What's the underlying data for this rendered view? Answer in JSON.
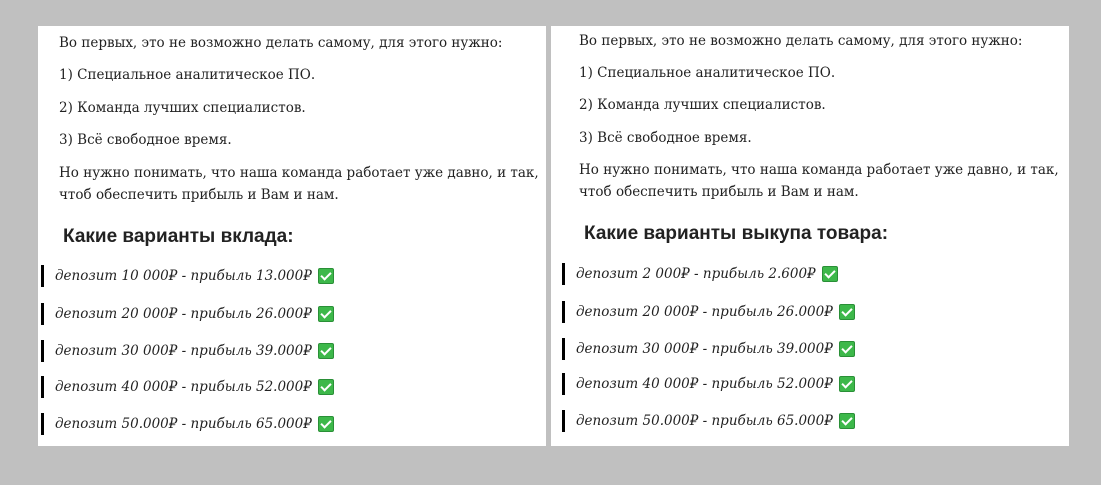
{
  "left": {
    "intro": "Во первых, это не возможно делать самому, для этого нужно:",
    "list": [
      "1) Специальное аналитическое ПО.",
      "2) Команда лучших специалистов.",
      "3) Всё свободное время."
    ],
    "note": "Но нужно понимать, что наша команда работает уже давно, и так, чтоб обеспечить прибыль и Вам и нам.",
    "heading": "Какие варианты вклада:",
    "offers": [
      "депозит 10 000₽ - прибыль 13.000₽",
      "депозит 20 000₽ - прибыль 26.000₽",
      "депозит 30 000₽ - прибыль 39.000₽",
      "депозит 40 000₽ - прибыль 52.000₽",
      "депозит 50.000₽ - прибыль 65.000₽"
    ]
  },
  "right": {
    "intro": "Во первых, это не возможно делать самому, для этого нужно:",
    "list": [
      "1) Специальное аналитическое ПО.",
      "2) Команда лучших специалистов.",
      "3) Всё свободное время."
    ],
    "note": "Но нужно понимать, что наша команда работает уже давно, и так, чтоб обеспечить прибыль и Вам и нам.",
    "heading": "Какие варианты выкупа товара:",
    "offers": [
      "депозит 2 000₽ - прибыль 2.600₽",
      "депозит 20 000₽ - прибыль 26.000₽",
      "депозит 30 000₽ - прибыль 39.000₽",
      "депозит 40 000₽ - прибыль 52.000₽",
      "депозит 50.000₽ - прибыль 65.000₽"
    ]
  },
  "icons": {
    "check": "check-mark-icon"
  },
  "colors": {
    "background": "#c0c0c0",
    "panel": "#ffffff",
    "check": "#3db84a"
  }
}
